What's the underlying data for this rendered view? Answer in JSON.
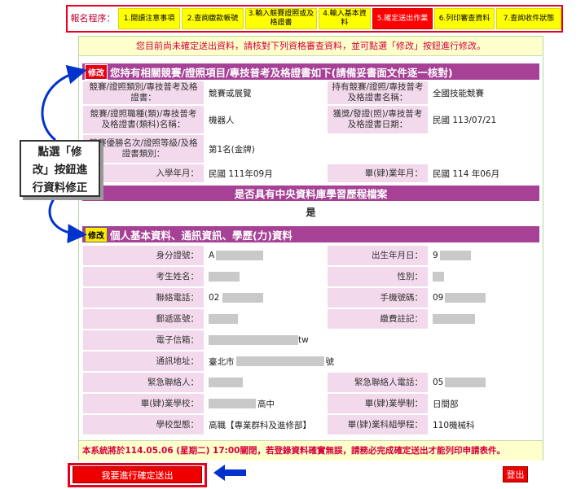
{
  "steps": {
    "label": "報名程序：",
    "items": [
      {
        "label": "1.閱讀注意事項"
      },
      {
        "label": "2.查詢繳款帳號"
      },
      {
        "label": "3.輸入競賽證照或及格證書"
      },
      {
        "label": "4.輸入基本資料"
      },
      {
        "label": "5.確定送出作業",
        "active": true
      },
      {
        "label": "6.列印審查資料"
      },
      {
        "label": "7.查詢收件狀態"
      }
    ]
  },
  "notice": "您目前尚未確定送出資料，請核對下列資格審查資料，並可點選「修改」按鈕進行修改。",
  "section1": {
    "edit_label": "修改",
    "title": "您持有相關競賽/證照項目/專技普考及格證書如下(請備妥書面文件逐一核對)",
    "rows": [
      {
        "l1": "競賽/證照類別/專技普考及格證書：",
        "v1": "競賽或展覽",
        "l2": "持有競賽/證照/專技普考及格證書名稱：",
        "v2": "全國技能競賽"
      },
      {
        "l1": "競賽/證照職種(類)/專技普考及格證書(類科)名稱：",
        "v1": "機器人",
        "l2": "獲獎/發證(照)/專技普考及格證書日期：",
        "v2": "民國 113/07/21"
      },
      {
        "l1": "競賽優勝名次/證照等級/及格證書類別：",
        "v1": "第1名(金牌)",
        "l2": "",
        "v2": ""
      },
      {
        "l1": "入學年月：",
        "v1": "民國 111年09月",
        "l2": "畢(肄)業年月：",
        "v2": "民國 114 年06月"
      }
    ]
  },
  "section_db": {
    "title": "是否具有中央資料庫學習歷程檔案",
    "value": "是"
  },
  "section2": {
    "edit_label": "修改",
    "title": "個人基本資料、通訊資訊、學歷(力)資料",
    "rows": [
      {
        "l1": "身分證號：",
        "v1": "A",
        "l2": "出生年月日：",
        "v2": "9"
      },
      {
        "l1": "考生姓名：",
        "v1": "",
        "l2": "性別：",
        "v2": ""
      },
      {
        "l1": "聯絡電話：",
        "v1": "02",
        "l2": "手機號碼：",
        "v2": "09"
      },
      {
        "l1": "郵遞區號：",
        "v1": "",
        "l2": "繳費註記：",
        "v2": ""
      },
      {
        "l1": "電子信箱：",
        "v1": "tw",
        "full": true
      },
      {
        "l1": "通訊地址：",
        "v1": "臺北市",
        "v1_suffix": "號",
        "full": true
      },
      {
        "l1": "緊急聯絡人：",
        "v1": "",
        "l2": "緊急聯絡人電話：",
        "v2": "05"
      },
      {
        "l1": "畢(肄)業學校：",
        "v1": "高中",
        "l2": "畢(肄)業學制：",
        "v2": "日間部"
      },
      {
        "l1": "學校型態：",
        "v1": "高職【專業群科及進修部】",
        "l2": "畢(肄)業科組學程：",
        "v2": "110機械科"
      }
    ]
  },
  "deadline": "本系統將於114.05.06 (星期二) 17:00關閉，若登錄資料確實無誤，請務必完成確定送出才能列印申請表件。",
  "buttons": {
    "submit": "我要進行確定送出",
    "logout": "登出"
  },
  "callout": "點選「修改」按鈕進行資料修正",
  "callout_lines": [
    "點選「修",
    "改」按鈕進",
    "行資料修正"
  ],
  "colors": {
    "accent_red": "#e6001e",
    "section_purple": "#a64196",
    "label_pink": "#f3d9ec",
    "step_yellow": "#ffff00",
    "arrow_blue": "#0033cc"
  }
}
